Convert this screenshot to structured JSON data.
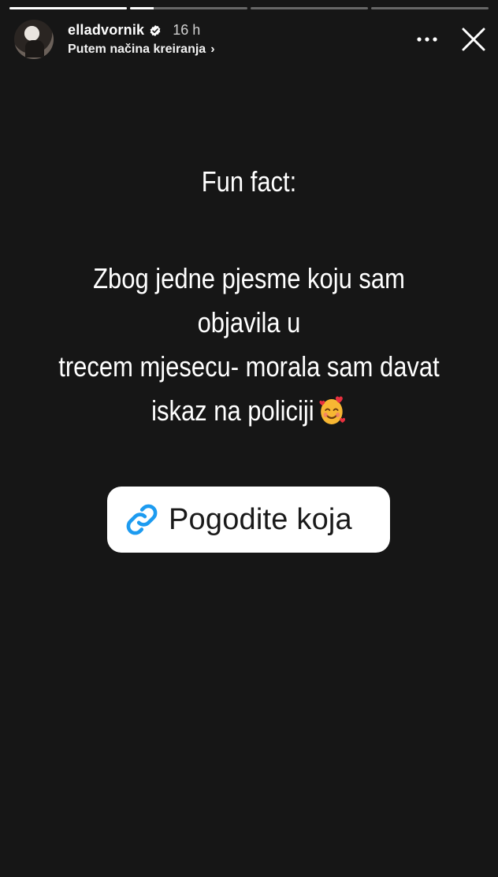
{
  "progress": {
    "segments": [
      {
        "fill": 1.0
      },
      {
        "fill": 0.2
      },
      {
        "fill": 0.0
      },
      {
        "fill": 0.0
      }
    ]
  },
  "header": {
    "username": "elladvornik",
    "time": "16 h",
    "subtitle": "Putem načina kreiranja",
    "chevron": "›"
  },
  "story": {
    "heading": "Fun fact:",
    "line1": "Zbog jedne pjesme koju sam objavila u",
    "line2": "trecem mjesecu- morala sam davat",
    "line3": "iskaz na policiji"
  },
  "link_sticker": {
    "label": "Pogodite koja"
  },
  "colors": {
    "background": "#161616",
    "link_icon": "#1d9bf0",
    "verified": "#ffffff"
  },
  "icons": {
    "more": "more-horizontal-icon",
    "close": "close-icon",
    "verified": "verified-badge-icon",
    "link": "link-icon",
    "emoji": "smiling-face-with-hearts-emoji"
  }
}
